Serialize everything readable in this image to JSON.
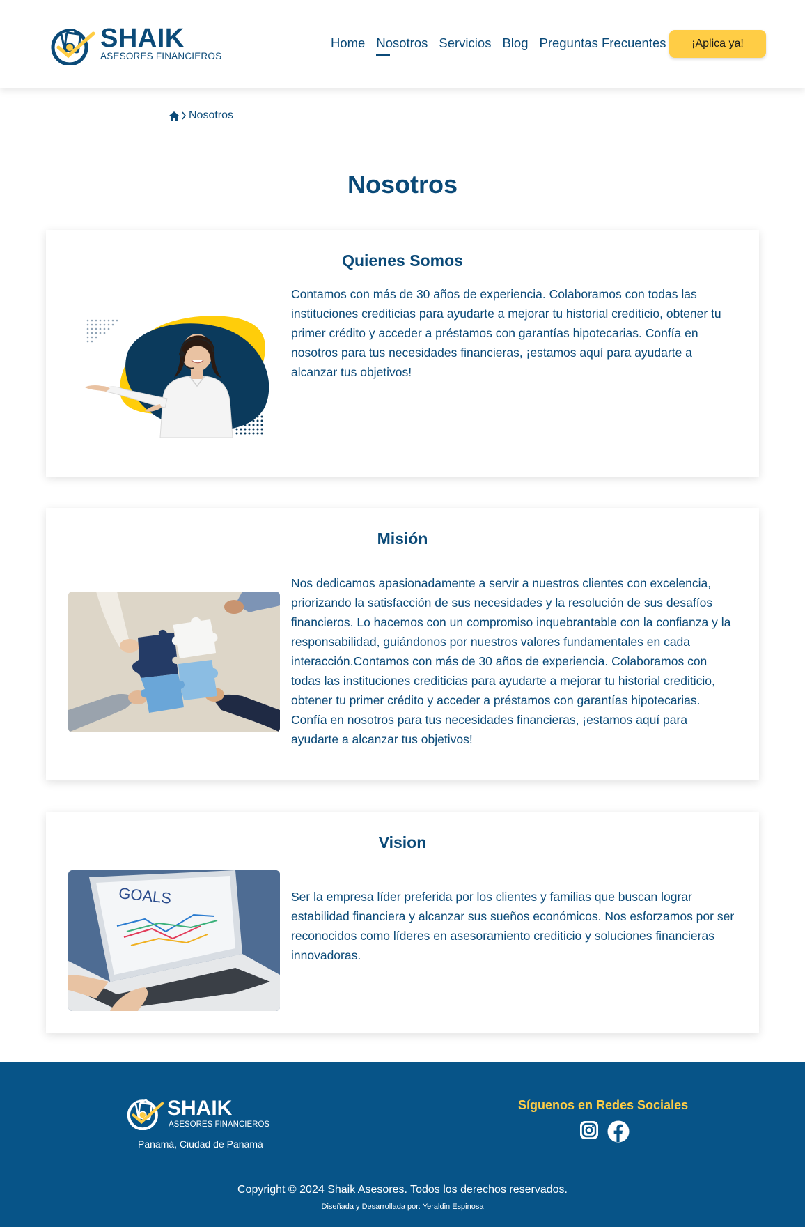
{
  "header": {
    "logo_name": "SHAIK",
    "logo_sub": "ASESORES FINANCIEROS",
    "nav": [
      {
        "label": "Home"
      },
      {
        "label": "Nosotros",
        "active": true
      },
      {
        "label": "Servicios"
      },
      {
        "label": "Blog"
      },
      {
        "label": "Preguntas Frecuentes"
      }
    ],
    "apply_label": "¡Aplica ya!"
  },
  "breadcrumb": {
    "home_icon": "home-icon",
    "current": "Nosotros"
  },
  "page_title": "Nosotros",
  "sections": {
    "quienes": {
      "title": "Quienes Somos",
      "text": "Contamos con más de 30 años de experiencia. Colaboramos con todas las instituciones crediticias para ayudarte a mejorar tu historial crediticio, obtener tu primer crédito y acceder a préstamos con garantías hipotecarias. Confía en nosotros para tus necesidades financieras, ¡estamos aquí para ayudarte a alcanzar tus objetivos!"
    },
    "mision": {
      "title": "Misión",
      "text": "Nos dedicamos apasionadamente a servir a nuestros clientes con excelencia, priorizando la satisfacción de sus necesidades y la resolución de sus desafíos financieros. Lo hacemos con un compromiso inquebrantable con la confianza y la responsabilidad, guiándonos por nuestros valores fundamentales en cada interacción.Contamos con más de 30 años de experiencia. Colaboramos con todas las instituciones crediticias para ayudarte a mejorar tu historial crediticio, obtener tu primer crédito y acceder a préstamos con garantías hipotecarias. Confía en nosotros para tus necesidades financieras, ¡estamos aquí para ayudarte a alcanzar tus objetivos!"
    },
    "vision": {
      "title": "Vision",
      "image_text": "GOALS",
      "text": "Ser la empresa líder preferida por los clientes y familias que buscan lograr estabilidad financiera y alcanzar sus sueños económicos. Nos esforzamos por ser reconocidos como líderes en asesoramiento crediticio y soluciones financieras innovadoras."
    }
  },
  "footer": {
    "logo_name": "SHAIK",
    "logo_sub": "ASESORES FINANCIEROS",
    "location": "Panamá, Ciudad de Panamá",
    "social_title": "Síguenos en Redes Sociales",
    "social_icons": [
      "instagram-icon",
      "facebook-icon"
    ],
    "copyright": "Copyright © 2024 Shaik Asesores. Todos los derechos reservados.",
    "credit": "Diseñada y Desarrollada por: Yeraldin Espinosa"
  },
  "colors": {
    "primary": "#0b4a78",
    "accent": "#ffcd45",
    "footer_bg": "#075488"
  }
}
